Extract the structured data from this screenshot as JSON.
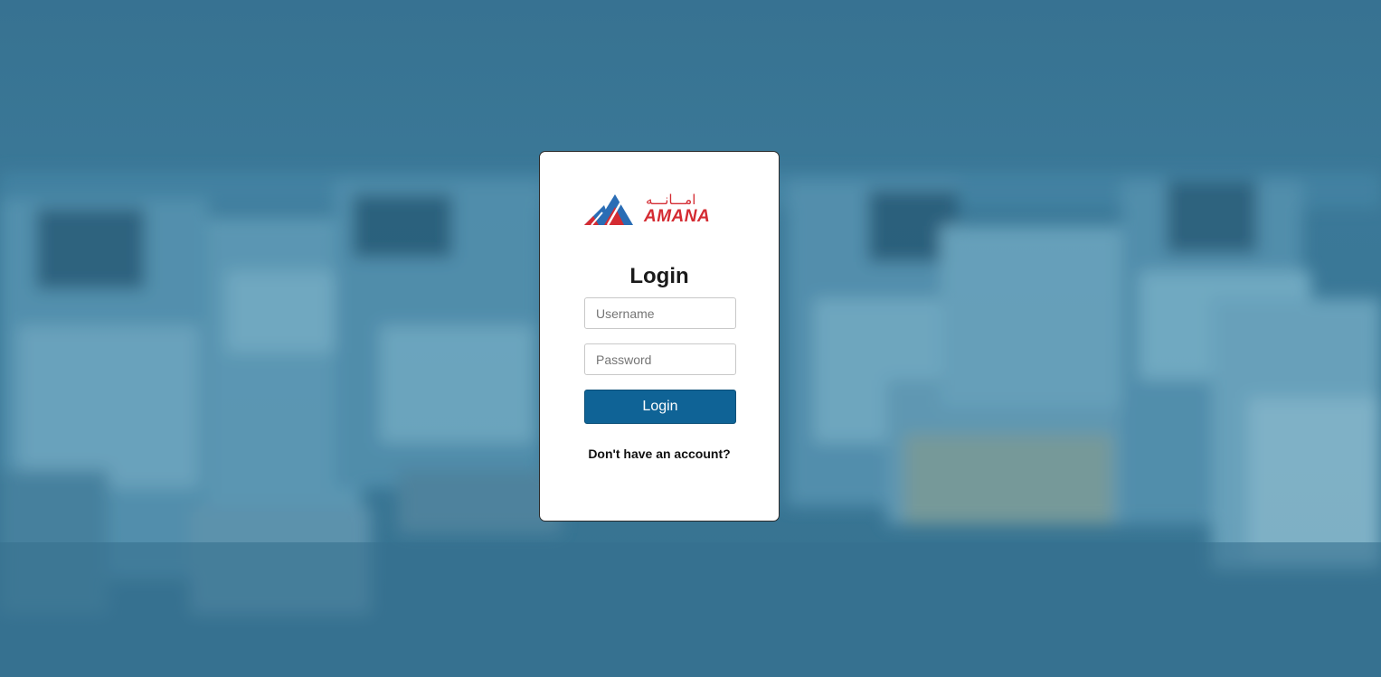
{
  "brand": {
    "name": "AMANA",
    "arabic_name": "امـــانـــه",
    "primary_color": "#d42b32",
    "secondary_color": "#2a6db5",
    "logo_icon": "amana-triangle-logo"
  },
  "background": {
    "color": "#3a7694",
    "image": "construction-vehicles-photo"
  },
  "login": {
    "title": "Login",
    "username_placeholder": "Username",
    "password_placeholder": "Password",
    "submit_label": "Login",
    "button_color": "#0f6396",
    "signup_link": "Don't have an account?"
  }
}
